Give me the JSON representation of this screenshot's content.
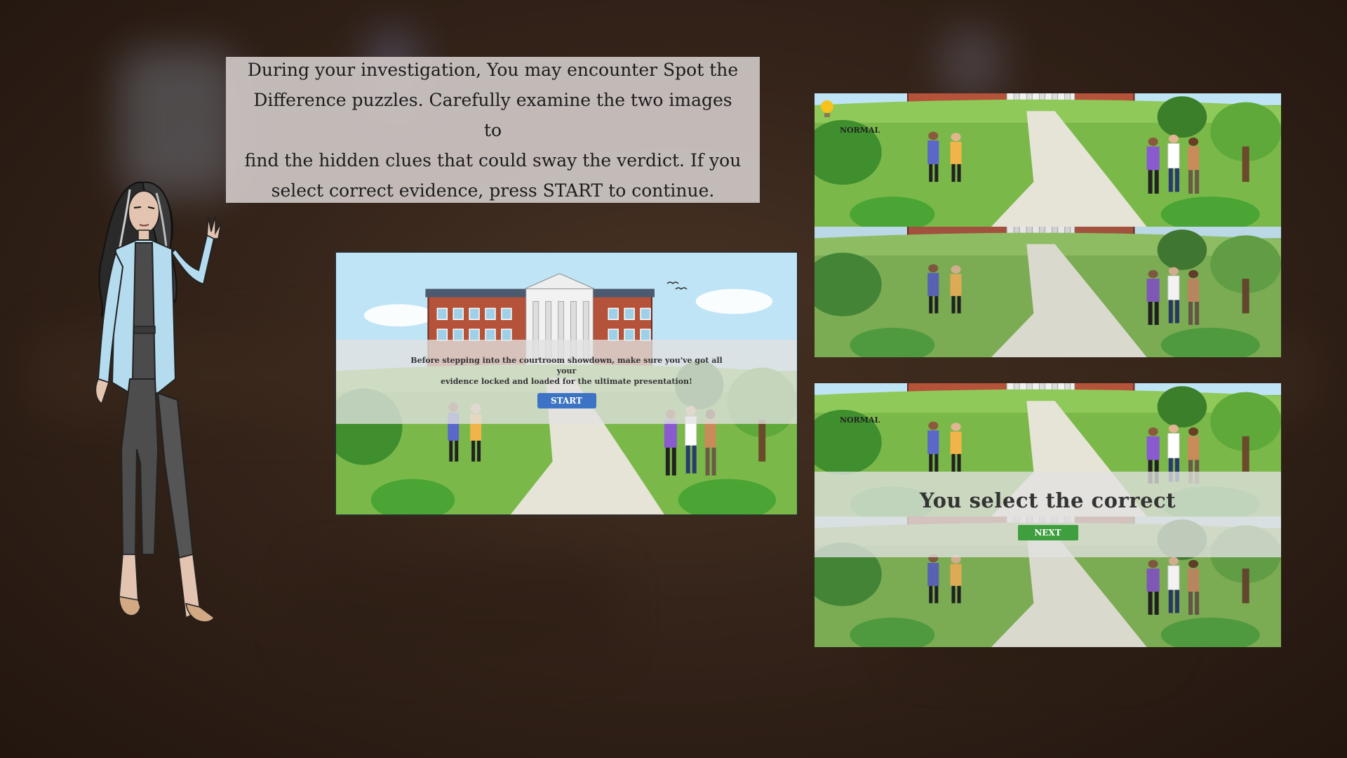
{
  "instruction": {
    "lines": [
      "During your investigation, You may encounter Spot the",
      "Difference puzzles. Carefully examine the two images to",
      "find the hidden clues that could sway the verdict. If you",
      "select correct evidence, press START to continue."
    ]
  },
  "start_screen": {
    "message_lines": [
      "Before stepping into the courtroom showdown, make sure you've got all your",
      "evidence locked and loaded for the ultimate presentation!"
    ],
    "start_label": "START"
  },
  "puzzle_screen": {
    "mode_label": "NORMAL",
    "hint_icon": "lightbulb-icon"
  },
  "result_screen": {
    "mode_label": "NORMAL",
    "result_text": "You  select the correct",
    "next_label": "NEXT"
  },
  "colors": {
    "start_button": "#3d73c4",
    "next_button": "#3f9e3d",
    "instruction_bg": "#cdc6c4",
    "background": "#35241a"
  }
}
